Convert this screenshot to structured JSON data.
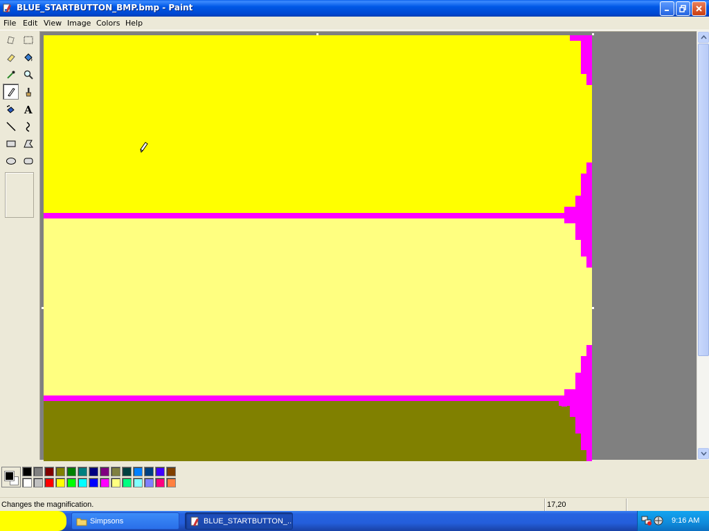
{
  "window": {
    "title": "BLUE_STARTBUTTON_BMP.bmp - Paint",
    "controls": [
      "minimize",
      "maximize",
      "close"
    ]
  },
  "menu": [
    {
      "label": "File"
    },
    {
      "label": "Edit"
    },
    {
      "label": "View"
    },
    {
      "label": "Image"
    },
    {
      "label": "Colors"
    },
    {
      "label": "Help"
    }
  ],
  "tools": [
    {
      "name": "free-form-select-icon"
    },
    {
      "name": "select-icon"
    },
    {
      "name": "eraser-icon"
    },
    {
      "name": "fill-bucket-icon"
    },
    {
      "name": "pick-color-icon"
    },
    {
      "name": "magnifier-icon"
    },
    {
      "name": "pencil-icon",
      "selected": true
    },
    {
      "name": "brush-icon"
    },
    {
      "name": "airbrush-icon"
    },
    {
      "name": "text-icon"
    },
    {
      "name": "line-icon"
    },
    {
      "name": "curve-icon"
    },
    {
      "name": "rectangle-icon"
    },
    {
      "name": "polygon-icon"
    },
    {
      "name": "ellipse-icon"
    },
    {
      "name": "rounded-rectangle-icon"
    }
  ],
  "canvas": {
    "colors": {
      "yellow": "#ffff00",
      "light_yellow": "#ffff80",
      "magenta": "#ff00ff",
      "olive": "#808000"
    }
  },
  "palette": {
    "foreground": "#000000",
    "background": "#ffffff",
    "top_row": [
      "#000000",
      "#808080",
      "#800000",
      "#808000",
      "#008000",
      "#008080",
      "#000080",
      "#800080",
      "#808040",
      "#004040",
      "#0080ff",
      "#004080",
      "#4000ff",
      "#804000"
    ],
    "bottom_row": [
      "#ffffff",
      "#c0c0c0",
      "#ff0000",
      "#ffff00",
      "#00ff00",
      "#00ffff",
      "#0000ff",
      "#ff00ff",
      "#ffff80",
      "#00ff80",
      "#80ffff",
      "#8080ff",
      "#ff0080",
      "#ff8040"
    ]
  },
  "status": {
    "text": "Changes the magnification.",
    "coords": "17,20"
  },
  "taskbar": {
    "tasks": [
      {
        "label": "Simpsons"
      },
      {
        "label": "BLUE_STARTBUTTON_..."
      }
    ],
    "clock": "9:16 AM"
  }
}
